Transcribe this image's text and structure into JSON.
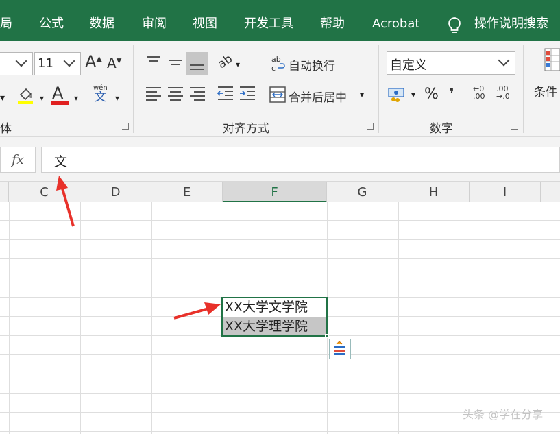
{
  "menu": {
    "items": [
      "局",
      "公式",
      "数据",
      "审阅",
      "视图",
      "开发工具",
      "帮助",
      "Acrobat"
    ],
    "tell_me": "操作说明搜索"
  },
  "ribbon": {
    "font_size": "11",
    "wrap_text": "自动换行",
    "merge_center": "合并后居中",
    "number_format": "自定义",
    "group_font": "体",
    "group_align": "对齐方式",
    "group_number": "数字",
    "cond_format": "条件",
    "phonetic_top": "wén",
    "phonetic_bottom": "文",
    "percent": "%",
    "comma": "❜",
    "inc_dec_top": "←0",
    "inc_dec_bottom": ".00",
    "dec_dec_top": ".00",
    "dec_dec_bottom": "→.0",
    "font_a": "A",
    "grow": "A",
    "shrink": "A",
    "orientation": "ab"
  },
  "formula_bar": {
    "fx": "fx",
    "value": "文"
  },
  "columns": [
    "C",
    "D",
    "E",
    "F",
    "G",
    "H",
    "I"
  ],
  "cells": {
    "f1": "XX大学文学院",
    "f2": "XX大学理学院"
  },
  "watermark": "头条 @学在分享",
  "colors": {
    "accent": "#217346",
    "arrow": "#e8312a",
    "fill_yellow": "#ffff00",
    "font_red": "#e02020"
  }
}
